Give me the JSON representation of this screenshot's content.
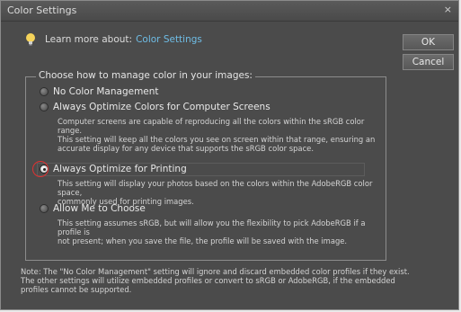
{
  "window": {
    "title": "Color Settings",
    "close_label": "×"
  },
  "learn_more": {
    "label": "Learn more about:",
    "link": "Color Settings"
  },
  "buttons": {
    "ok": "OK",
    "cancel": "Cancel"
  },
  "group": {
    "legend": "Choose how to manage color in your images:",
    "options": [
      {
        "label": "No Color Management",
        "selected": false
      },
      {
        "label": "Always Optimize Colors for Computer Screens",
        "selected": false,
        "description": "Computer screens are capable of reproducing all the colors within the sRGB color range.\nThis setting will keep all the colors you see on screen within that range, ensuring an\naccurate display for any device that supports the sRGB color space."
      },
      {
        "label": "Always Optimize for Printing",
        "selected": true,
        "description": "This setting will display your photos based on the colors within the AdobeRGB color space,\ncommonly used for printing images."
      },
      {
        "label": "Allow Me to Choose",
        "selected": false,
        "description": "This setting assumes sRGB, but will allow you the flexibility to pick AdobeRGB if a profile is\nnot present; when you save the file, the profile will be saved with the image."
      }
    ]
  },
  "note": "Note: The \"No Color Management\" setting will ignore and discard embedded color profiles if they exist.\nThe other settings will utilize embedded profiles or convert to sRGB or AdobeRGB, if the embedded\nprofiles cannot be supported.",
  "colors": {
    "link": "#6fbde6",
    "dialog_bg": "#4b4b4b",
    "annotation": "#e03131"
  }
}
